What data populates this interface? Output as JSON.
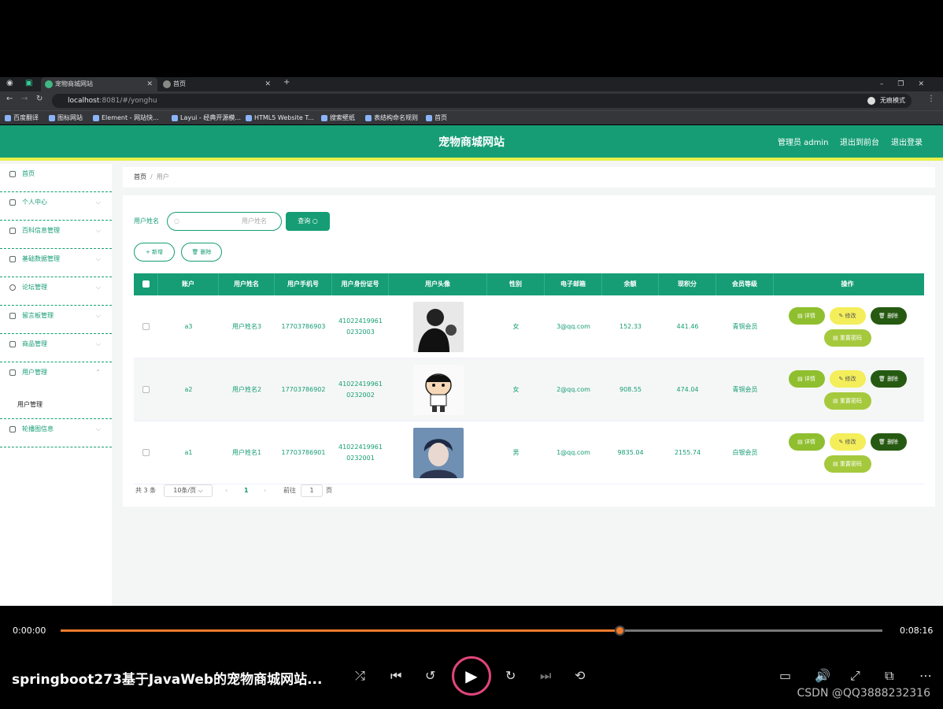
{
  "browser": {
    "tabs": [
      {
        "label": "宠物商城网站"
      },
      {
        "label": "首页"
      }
    ],
    "url_host": "localhost",
    "url_path": ":8081/#/yonghu",
    "incognito_label": "无痕模式",
    "bookmarks": [
      "百度翻译",
      "图标网站",
      "Element - 网站快...",
      "Layui - 经典开源模...",
      "HTML5 Website T...",
      "搜索壁纸",
      "表结构命名规则",
      "首页"
    ]
  },
  "header": {
    "title": "宠物商城网站",
    "admin": "管理员 admin",
    "front": "退出到前台",
    "logout": "退出登录"
  },
  "sidebar": {
    "items": [
      "首页",
      "个人中心",
      "百科信息管理",
      "基础数据管理",
      "论坛管理",
      "留言板管理",
      "商品管理",
      "用户管理"
    ],
    "sub_item": "用户管理",
    "last_item": "轮播图信息"
  },
  "breadcrumb": {
    "home": "首页",
    "sep": "/",
    "current": "用户"
  },
  "search": {
    "label": "用户姓名",
    "placeholder": "用户姓名",
    "button": "查询"
  },
  "toolbar": {
    "add": "+ 新增",
    "delete": "删除"
  },
  "table": {
    "columns": [
      "账户",
      "用户姓名",
      "用户手机号",
      "用户身份证号",
      "用户头像",
      "性别",
      "电子邮箱",
      "余额",
      "现积分",
      "会员等级",
      "操作"
    ],
    "rows": [
      {
        "account": "a3",
        "name": "用户姓名3",
        "phone": "17703786903",
        "id1": "41022419961",
        "id2": "0232003",
        "gender": "女",
        "email": "3@qq.com",
        "balance": "152.33",
        "points": "441.46",
        "level": "青铜会员"
      },
      {
        "account": "a2",
        "name": "用户姓名2",
        "phone": "17703786902",
        "id1": "41022419961",
        "id2": "0232002",
        "gender": "女",
        "email": "2@qq.com",
        "balance": "908.55",
        "points": "474.04",
        "level": "青铜会员"
      },
      {
        "account": "a1",
        "name": "用户姓名1",
        "phone": "17703786901",
        "id1": "41022419961",
        "id2": "0232001",
        "gender": "男",
        "email": "1@qq.com",
        "balance": "9835.04",
        "points": "2155.74",
        "level": "白银会员"
      }
    ],
    "actions": {
      "detail": "详情",
      "edit": "修改",
      "delete": "删除",
      "reset": "重置密码"
    }
  },
  "pager": {
    "total": "共 3 条",
    "size": "10条/页",
    "page": "1",
    "goto": "前往",
    "goto_value": "1",
    "page_unit": "页"
  },
  "video": {
    "current": "0:00:00",
    "duration": "0:08:16",
    "progress": 0.68,
    "title": "springboot273基于JavaWeb的宠物商城网站...",
    "watermark": "CSDN @QQ3888232316"
  },
  "colors": {
    "primary": "#169d75",
    "accent": "#e6f04a",
    "progress": "#f07a2b"
  }
}
